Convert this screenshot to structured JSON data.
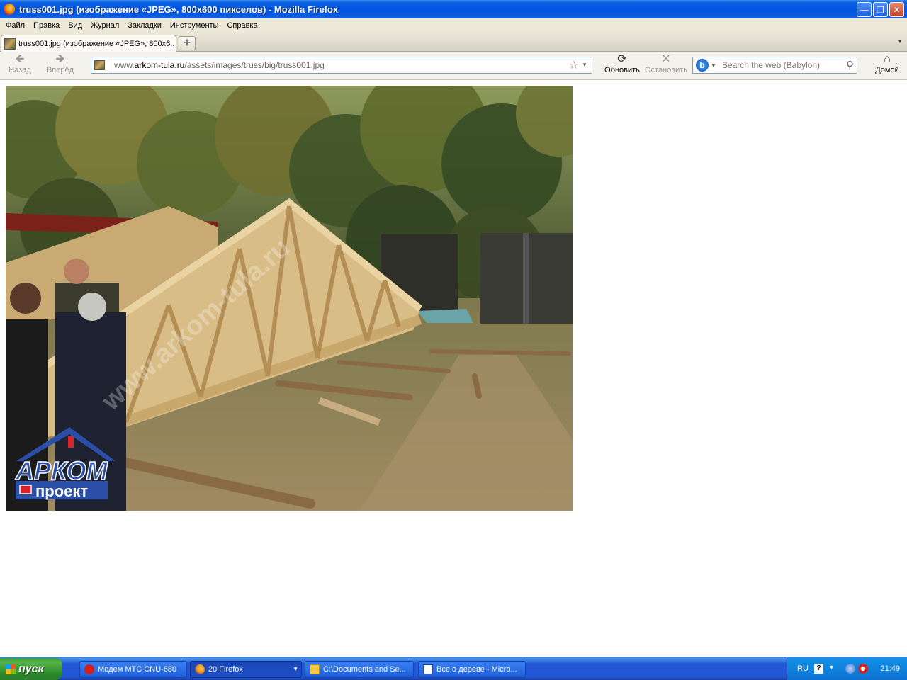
{
  "window": {
    "title": "truss001.jpg (изображение «JPEG», 800x600 пикселов) - Mozilla Firefox"
  },
  "menu": [
    "Файл",
    "Правка",
    "Вид",
    "Журнал",
    "Закладки",
    "Инструменты",
    "Справка"
  ],
  "tabs": [
    {
      "label": "truss001.jpg (изображение «JPEG», 800x6..."
    }
  ],
  "newtab_label": "+",
  "nav": {
    "back": "Назад",
    "forward": "Вперёд",
    "reload": "Обновить",
    "stop": "Остановить",
    "home": "Домой"
  },
  "url": {
    "prefix": "www.",
    "domain": "arkom-tula.ru",
    "path": "/assets/images/truss/big/truss001.jpg"
  },
  "search": {
    "placeholder": "Search the web (Babylon)"
  },
  "watermark": {
    "text": "www.arkom-tula.ru",
    "logo_top": "АРКОМ",
    "logo_bottom": "проект"
  },
  "taskbar": {
    "start": "пуск",
    "buttons": [
      {
        "label": "Модем МТС CNU-680"
      },
      {
        "label": "20 Firefox"
      },
      {
        "label": "C:\\Documents and Se..."
      },
      {
        "label": "Все о дереве - Micro..."
      }
    ],
    "tray": {
      "lang": "RU",
      "help": "?",
      "clock": "21:49"
    }
  },
  "colors": {
    "xp_blue": "#0054e3",
    "start_green": "#3c9e3c",
    "menu_bg": "#ece9d8",
    "logo_blue": "#2b4fa8",
    "logo_red": "#d8232a"
  }
}
